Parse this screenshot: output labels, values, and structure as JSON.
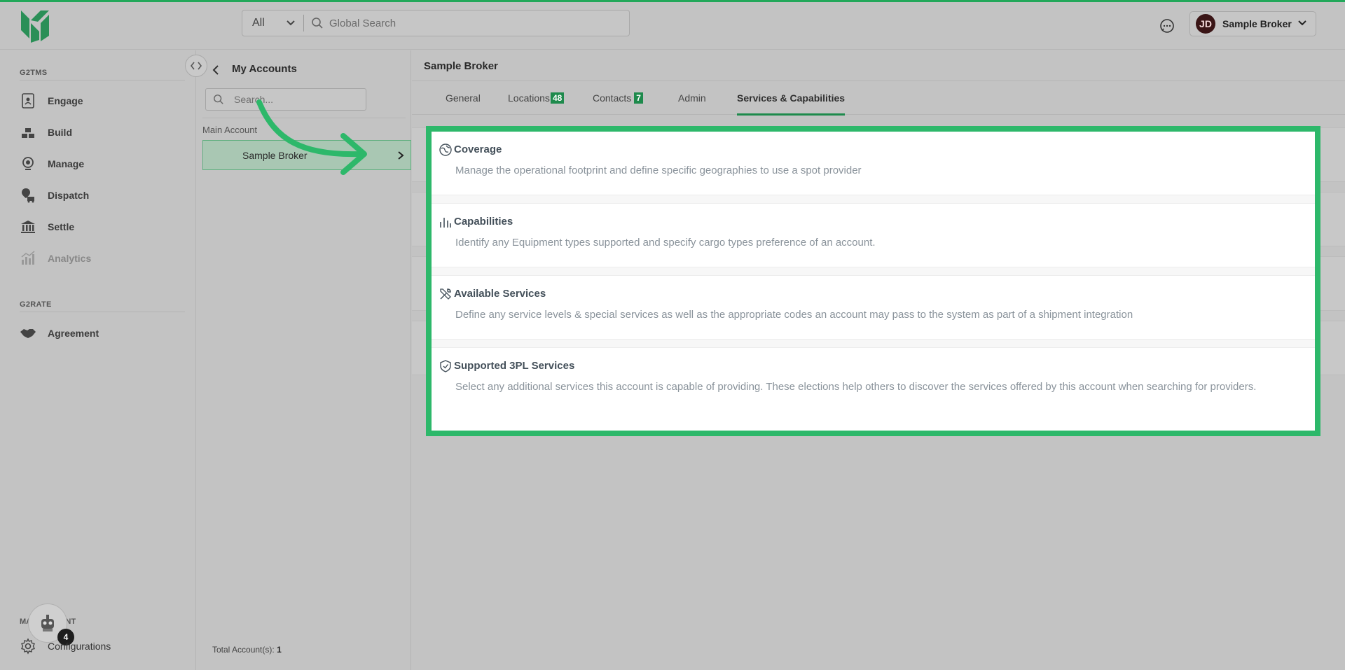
{
  "header": {
    "search_scope": "All",
    "search_placeholder": "Global Search",
    "user_initials": "JD",
    "user_name": "Sample Broker"
  },
  "sidebar": {
    "sections": [
      {
        "label": "G2TMS",
        "items": [
          {
            "label": "Engage",
            "icon": "engage-icon"
          },
          {
            "label": "Build",
            "icon": "build-icon"
          },
          {
            "label": "Manage",
            "icon": "manage-icon"
          },
          {
            "label": "Dispatch",
            "icon": "dispatch-icon"
          },
          {
            "label": "Settle",
            "icon": "settle-icon"
          },
          {
            "label": "Analytics",
            "icon": "analytics-icon",
            "disabled": true
          }
        ]
      },
      {
        "label": "G2RATE",
        "items": [
          {
            "label": "Agreement",
            "icon": "handshake-icon"
          }
        ]
      }
    ],
    "management_label": "MANAGEMENT",
    "configurations_label": "Configurations",
    "bot_badge_count": "4"
  },
  "accounts": {
    "title": "My Accounts",
    "search_placeholder": "Search...",
    "group_label": "Main Account",
    "selected_account": "Sample Broker",
    "total_label": "Total Account(s):",
    "total_value": "1"
  },
  "main": {
    "title": "Sample Broker",
    "tabs": [
      {
        "label": "General"
      },
      {
        "label": "Locations",
        "badge": "48"
      },
      {
        "label": "Contacts",
        "badge": "7"
      },
      {
        "label": "Admin"
      },
      {
        "label": "Services & Capabilities",
        "active": true
      }
    ],
    "cards": [
      {
        "title": "Coverage",
        "icon": "globe-icon",
        "description": "Manage the operational footprint and define specific geographies to use a spot provider"
      },
      {
        "title": "Capabilities",
        "icon": "bar-chart-icon",
        "description": "Identify any Equipment types supported and specify cargo types preference of an account."
      },
      {
        "title": "Available Services",
        "icon": "tools-icon",
        "description": "Define any service levels & special services as well as the appropriate codes an account may pass to the system as part of a shipment integration"
      },
      {
        "title": "Supported 3PL Services",
        "icon": "shield-check-icon",
        "description": "Select any additional services this account is capable of providing. These elections help others to discover the services offered by this account when searching for providers."
      }
    ]
  },
  "colors": {
    "brand_green": "#1e8a4c",
    "highlight_green": "#2db86a",
    "overlay_gray": "#c3c3c3"
  }
}
